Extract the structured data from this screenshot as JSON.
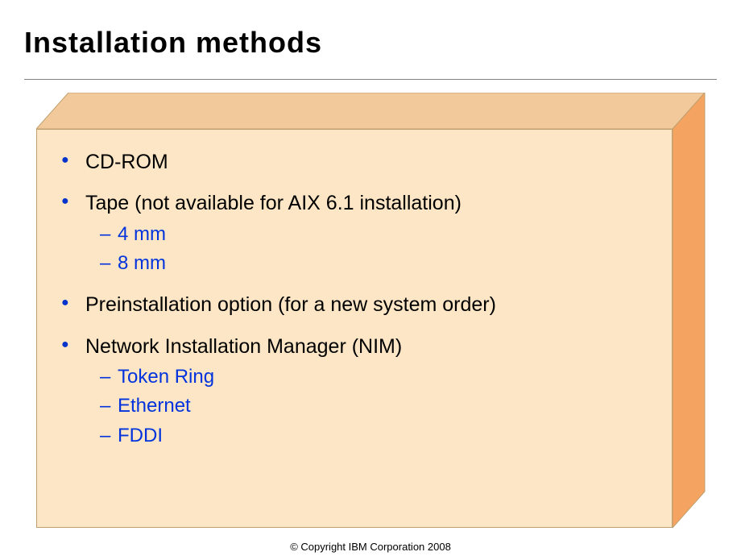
{
  "title": "Installation methods",
  "copyright": "© Copyright IBM Corporation 2008",
  "colors": {
    "box_front": "#fde6c5",
    "box_top": "#f2c99a",
    "box_side": "#f4a460",
    "bullet": "#0033cc",
    "sub_text": "#0033dd"
  },
  "bullets": [
    {
      "label": "CD-ROM",
      "sub": []
    },
    {
      "label": "Tape (not available for AIX 6.1 installation)",
      "sub": [
        "4 mm",
        "8 mm"
      ]
    },
    {
      "label": "Preinstallation option (for a new system order)",
      "sub": []
    },
    {
      "label": "Network Installation Manager (NIM)",
      "sub": [
        "Token Ring",
        "Ethernet",
        "FDDI"
      ]
    }
  ]
}
